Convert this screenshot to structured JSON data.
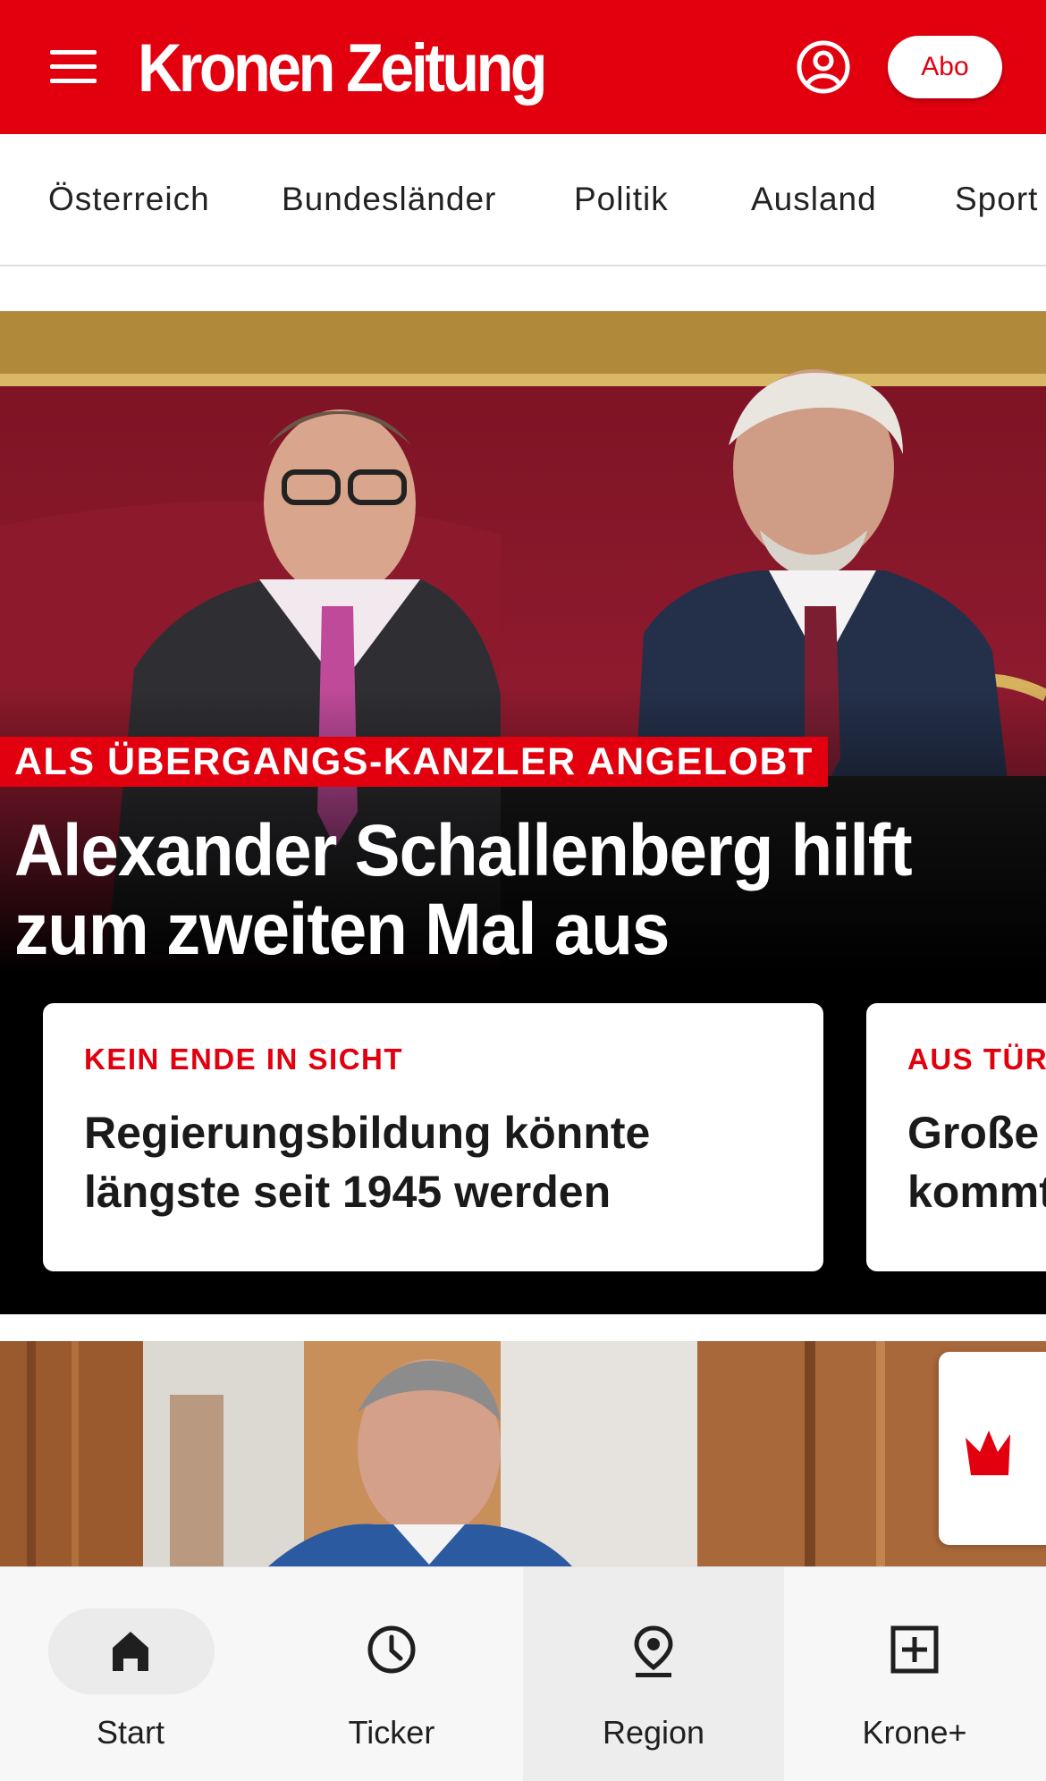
{
  "header": {
    "logo_text": "Kronen Zeitung",
    "abo_label": "Abo",
    "brand_color": "#e2000f"
  },
  "categories": [
    "Österreich",
    "Bundesländer",
    "Politik",
    "Ausland",
    "Sport"
  ],
  "hero": {
    "kicker": "ALS ÜBERGANGS-KANZLER ANGELOBT",
    "headline": "Alexander Schallenberg hilft zum zweiten Mal aus"
  },
  "cards": [
    {
      "kicker": "KEIN ENDE IN SICHT",
      "title_line1": "Regierungsbildung könnte",
      "title_line2": "längste seit 1945 werden"
    },
    {
      "kicker": "AUS TÜR",
      "title_line1": "Große",
      "title_line2": "kommt"
    }
  ],
  "bottom_nav": [
    {
      "label": "Start",
      "icon": "home-icon",
      "active": true
    },
    {
      "label": "Ticker",
      "icon": "clock-icon",
      "active": false
    },
    {
      "label": "Region",
      "icon": "location-pin-icon",
      "active": false
    },
    {
      "label": "Krone+",
      "icon": "plus-box-icon",
      "active": false
    }
  ]
}
